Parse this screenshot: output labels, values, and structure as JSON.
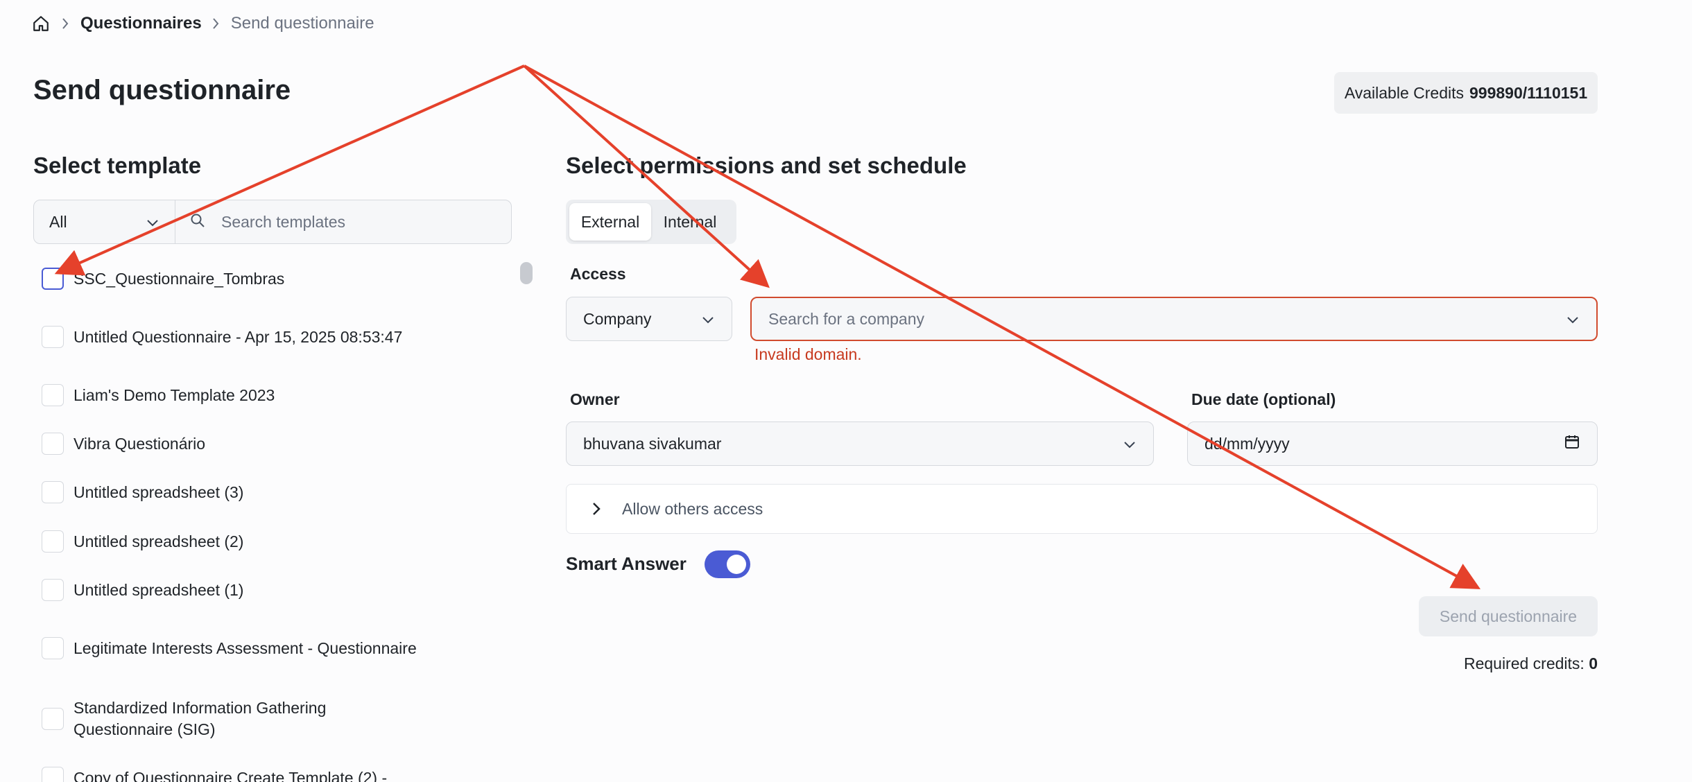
{
  "breadcrumb": {
    "home_icon": "home-icon",
    "items": [
      "Questionnaires",
      "Send questionnaire"
    ]
  },
  "page": {
    "title": "Send questionnaire",
    "credits_label": "Available Credits",
    "credits_value": "999890/1110151"
  },
  "templates": {
    "heading": "Select template",
    "filter_value": "All",
    "search_placeholder": "Search templates",
    "items": [
      "SSC_Questionnaire_Tombras",
      "Untitled Questionnaire - Apr 15, 2025 08:53:47",
      "Liam's Demo Template 2023",
      "Vibra Questionário",
      "Untitled spreadsheet (3)",
      "Untitled spreadsheet (2)",
      "Untitled spreadsheet (1)",
      "Legitimate Interests Assessment - Questionnaire",
      "Standardized Information Gathering Questionnaire (SIG)",
      "Copy of Questionnaire Create Template (2) -"
    ]
  },
  "permissions": {
    "heading": "Select permissions and set schedule",
    "tabs": [
      "External",
      "Internal"
    ],
    "active_tab": "External",
    "access_label": "Access",
    "access_type": "Company",
    "company_placeholder": "Search for a company",
    "error": "Invalid domain.",
    "owner_label": "Owner",
    "owner_value": "bhuvana sivakumar",
    "due_label": "Due date (optional)",
    "due_placeholder": "dd/mm/yyyy",
    "allow_others": "Allow others access",
    "smart_answer_label": "Smart Answer",
    "smart_answer_on": true,
    "send_label": "Send questionnaire",
    "required_credits_label": "Required credits:",
    "required_credits_value": "0"
  },
  "colors": {
    "accent": "#4a5bd4",
    "error": "#c73a1f",
    "annotation_arrow": "#e5412b"
  }
}
